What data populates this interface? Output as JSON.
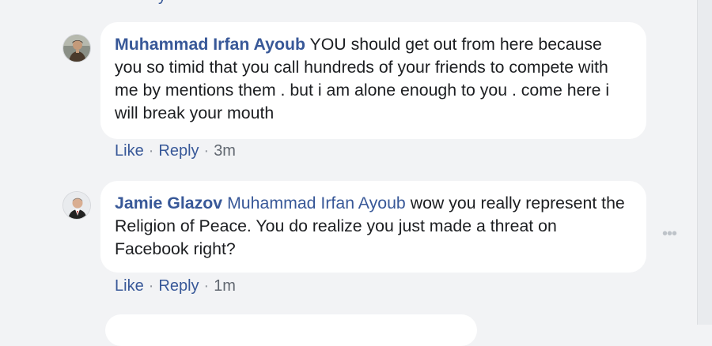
{
  "top_partial": "y",
  "comments": [
    {
      "author": "Muhammad Irfan Ayoub",
      "text": "YOU should get out from here because you so timid that you call hundreds of your friends to compete with me by mentions them . but i am alone enough to you . come here i will break your mouth",
      "actions": {
        "like": "Like",
        "reply": "Reply",
        "time": "3m"
      }
    },
    {
      "author": "Jamie Glazov",
      "mention": "Muhammad Irfan Ayoub",
      "text": "wow you really represent the Religion of Peace. You do realize you just made a threat on Facebook right?",
      "actions": {
        "like": "Like",
        "reply": "Reply",
        "time": "1m"
      }
    }
  ],
  "separator": "·",
  "more_options": "•••",
  "colors": {
    "link": "#385898",
    "bubble": "#ffffff",
    "background": "#f2f3f5"
  }
}
